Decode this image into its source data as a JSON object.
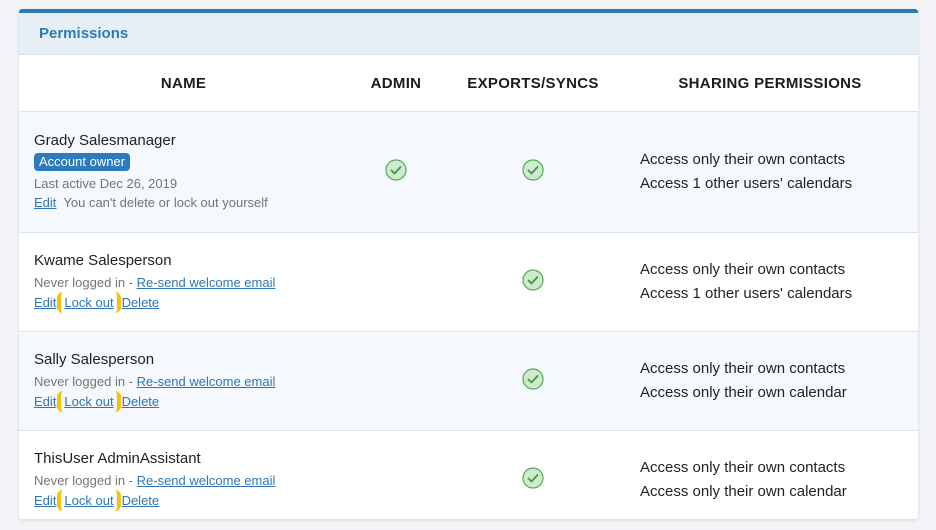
{
  "panel": {
    "title": "Permissions"
  },
  "columns": {
    "name": "NAME",
    "admin": "ADMIN",
    "exports": "EXPORTS/SYNCS",
    "sharing": "SHARING PERMISSIONS"
  },
  "users": [
    {
      "name": "Grady Salesmanager",
      "badge": "Account owner",
      "status": "Last active Dec 26, 2019",
      "edit": "Edit",
      "note": "You can't delete or lock out yourself",
      "admin": true,
      "exports": true,
      "sharing": [
        "Access only their own contacts",
        "Access 1 other users' calendars"
      ]
    },
    {
      "name": "Kwame Salesperson",
      "status": "Never logged in -",
      "resend": "Re-send welcome email",
      "edit": "Edit",
      "lock": "Lock out",
      "delete": "Delete",
      "admin": false,
      "exports": true,
      "sharing": [
        "Access only their own contacts",
        "Access 1 other users' calendars"
      ]
    },
    {
      "name": "Sally Salesperson",
      "status": "Never logged in -",
      "resend": "Re-send welcome email",
      "edit": "Edit",
      "lock": "Lock out",
      "delete": "Delete",
      "admin": false,
      "exports": true,
      "sharing": [
        "Access only their own contacts",
        "Access only their own calendar"
      ]
    },
    {
      "name": "ThisUser AdminAssistant",
      "status": "Never logged in -",
      "resend": "Re-send welcome email",
      "edit": "Edit",
      "lock": "Lock out",
      "delete": "Delete",
      "admin": false,
      "exports": true,
      "sharing": [
        "Access only their own contacts",
        "Access only their own calendar"
      ]
    }
  ],
  "colors": {
    "accent": "#2e7bb5",
    "check": "#5cb85c",
    "highlight": "#f5c400"
  },
  "icons": {
    "check": "check-circle-icon"
  }
}
